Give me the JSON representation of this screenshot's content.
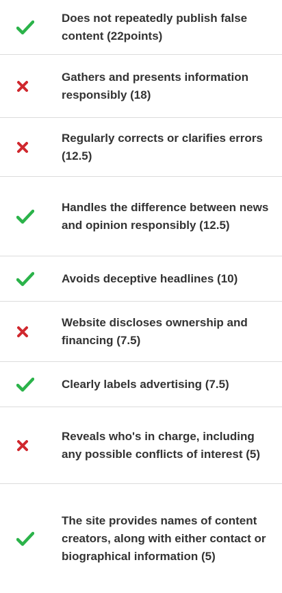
{
  "colors": {
    "pass": "#2bb34a",
    "fail": "#d0282e",
    "text": "#333333",
    "divider": "#dcdcdc"
  },
  "criteria": [
    {
      "label": "Does not repeatedly publish false content (22points)",
      "status": "pass",
      "icon": "check-icon"
    },
    {
      "label": "Gathers and presents information responsibly (18)",
      "status": "fail",
      "icon": "x-icon"
    },
    {
      "label": "Regularly corrects or clarifies errors (12.5)",
      "status": "fail",
      "icon": "x-icon"
    },
    {
      "label": "Handles the difference between news and opinion responsibly (12.5)",
      "status": "pass",
      "icon": "check-icon"
    },
    {
      "label": "Avoids deceptive headlines (10)",
      "status": "pass",
      "icon": "check-icon"
    },
    {
      "label": "Website discloses ownership and financing (7.5)",
      "status": "fail",
      "icon": "x-icon"
    },
    {
      "label": "Clearly labels advertising (7.5)",
      "status": "pass",
      "icon": "check-icon"
    },
    {
      "label": "Reveals who's in charge, including any possible conflicts of interest (5)",
      "status": "fail",
      "icon": "x-icon"
    },
    {
      "label": "The site provides names of content creators, along with either contact or biographical information (5)",
      "status": "pass",
      "icon": "check-icon"
    }
  ]
}
